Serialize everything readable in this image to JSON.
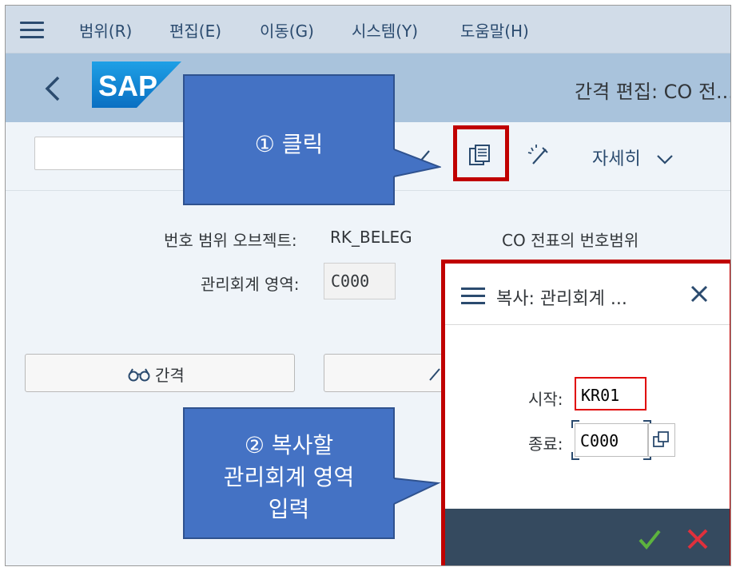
{
  "menubar": {
    "items": [
      "범위(R)",
      "편집(E)",
      "이동(G)",
      "시스템(Y)",
      "도움말(H)"
    ]
  },
  "shell": {
    "logo_text": "SAP",
    "title": "간격 편집: CO 전..."
  },
  "toolbar": {
    "more_label": "자세히"
  },
  "form": {
    "number_range_object_label": "번호 범위 오브젝트:",
    "number_range_object_value": "RK_BELEG",
    "number_range_object_desc": "CO 전표의 번호범위",
    "controlling_area_label": "관리회계 영역:",
    "controlling_area_value": "C000",
    "interval_button_label": "간격"
  },
  "callouts": {
    "step1": "① 클릭",
    "step2_line1": "② 복사할",
    "step2_line2": "관리회계 영역",
    "step2_line3": "입력"
  },
  "dialog": {
    "title": "복사: 관리회계 ...",
    "start_label": "시작:",
    "start_value": "KR01",
    "end_label": "종료:",
    "end_value": "C000"
  },
  "colors": {
    "accent_red": "#c00000",
    "callout_blue": "#4472c4",
    "shell_blue": "#a9c3dc",
    "footer_dark": "#354a5f",
    "ok_green": "#3b8c2a",
    "cancel_red": "#d32030"
  },
  "icons": {
    "menu": "hamburger-icon",
    "back": "back-arrow-icon",
    "copy": "copy-document-icon",
    "pencil": "pencil-icon",
    "edit_wand": "edit-wand-icon",
    "chevron": "chevron-down-icon",
    "glasses": "glasses-icon",
    "close": "close-icon",
    "value_help": "value-help-icon",
    "ok": "checkmark-icon",
    "cancel": "cancel-x-icon"
  }
}
